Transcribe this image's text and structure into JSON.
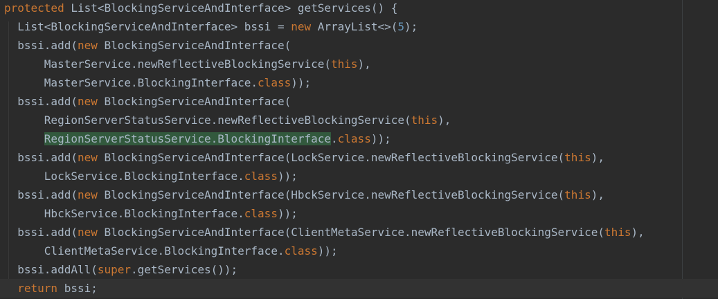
{
  "code": {
    "line1": {
      "kw_protected": "protected",
      "rest": " List<BlockingServiceAndInterface> getServices() {"
    },
    "line2": {
      "indent": "  ",
      "t1": "List<BlockingServiceAndInterface> bssi = ",
      "kw_new": "new",
      "t2": " ArrayList<>(",
      "num": "5",
      "t3": ");"
    },
    "line3": {
      "indent": "  ",
      "t1": "bssi.add(",
      "kw_new": "new",
      "t2": " BlockingServiceAndInterface("
    },
    "line4": {
      "indent": "      ",
      "t1": "MasterService.newReflectiveBlockingService(",
      "kw_this": "this",
      "t2": "),"
    },
    "line5": {
      "indent": "      ",
      "t1": "MasterService.BlockingInterface.",
      "kw_class": "class",
      "t2": "));"
    },
    "line6": {
      "indent": "  ",
      "t1": "bssi.add(",
      "kw_new": "new",
      "t2": " BlockingServiceAndInterface("
    },
    "line7": {
      "indent": "      ",
      "t1": "RegionServerStatusService.newReflectiveBlockingService(",
      "kw_this": "this",
      "t2": "),"
    },
    "line8": {
      "indent": "      ",
      "highlight": "RegionServerStatusService.BlockingInterface",
      "t1": ".",
      "kw_class": "class",
      "t2": "));"
    },
    "line9": {
      "indent": "  ",
      "t1": "bssi.add(",
      "kw_new": "new",
      "t2": " BlockingServiceAndInterface(LockService.newReflectiveBlockingService(",
      "kw_this": "this",
      "t3": "),"
    },
    "line10": {
      "indent": "      ",
      "t1": "LockService.BlockingInterface.",
      "kw_class": "class",
      "t2": "));"
    },
    "line11": {
      "indent": "  ",
      "t1": "bssi.add(",
      "kw_new": "new",
      "t2": " BlockingServiceAndInterface(HbckService.newReflectiveBlockingService(",
      "kw_this": "this",
      "t3": "),"
    },
    "line12": {
      "indent": "      ",
      "t1": "HbckService.BlockingInterface.",
      "kw_class": "class",
      "t2": "));"
    },
    "line13": {
      "indent": "  ",
      "t1": "bssi.add(",
      "kw_new": "new",
      "t2": " BlockingServiceAndInterface(ClientMetaService.newReflectiveBlockingService(",
      "kw_this": "this",
      "t3": "),"
    },
    "line14": {
      "indent": "      ",
      "t1": "ClientMetaService.BlockingInterface.",
      "kw_class": "class",
      "t2": "));"
    },
    "line15": {
      "indent": "  ",
      "t1": "bssi.addAll(",
      "kw_super": "super",
      "t2": ".getServices());"
    },
    "line16": {
      "indent": "  ",
      "kw_return": "return",
      "t1": " bssi;"
    }
  },
  "colors": {
    "background": "#2b2b2b",
    "text": "#a9b7c6",
    "keyword": "#cc7832",
    "number": "#6897bb",
    "highlight": "#32593d",
    "current_line": "#323232"
  }
}
